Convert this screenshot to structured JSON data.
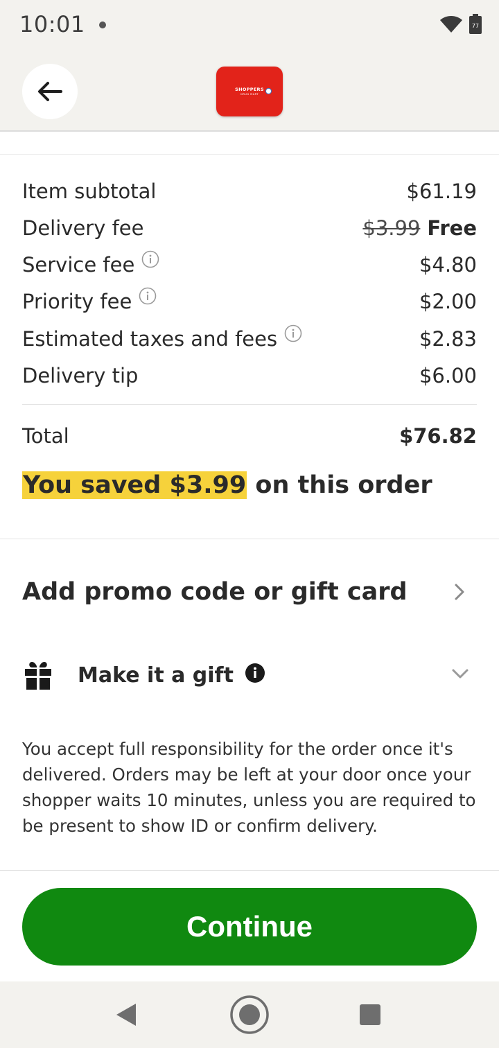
{
  "status_bar": {
    "time": "10:01",
    "battery_level": "77",
    "icons": [
      "wifi-icon",
      "battery-icon"
    ]
  },
  "header": {
    "back_icon": "arrow-left-icon",
    "store_logo": {
      "line1": "SHOPPERS",
      "line2": "DRUG MART",
      "color": "#e2231a"
    }
  },
  "fees": [
    {
      "label": "Item subtotal",
      "value": "$61.19",
      "has_info": false
    },
    {
      "label": "Delivery fee",
      "original_value": "$3.99",
      "value": "Free",
      "has_info": false
    },
    {
      "label": "Service fee",
      "value": "$4.80",
      "has_info": true
    },
    {
      "label": "Priority fee",
      "value": "$2.00",
      "has_info": true
    },
    {
      "label": "Estimated taxes and fees",
      "value": "$2.83",
      "has_info": true
    },
    {
      "label": "Delivery tip",
      "value": "$6.00",
      "has_info": false
    }
  ],
  "total": {
    "label": "Total",
    "value": "$76.82"
  },
  "savings": {
    "highlight": "You saved $3.99",
    "rest": " on this order",
    "highlight_color": "#f6d23b"
  },
  "promo": {
    "label": "Add promo code or gift card"
  },
  "gift": {
    "label": "Make it a gift"
  },
  "disclaimer": "You accept full responsibility for the order once it's delivered. Orders may be left at your door once your shopper waits 10 minutes, unless you are required to be present to show ID or confirm delivery.",
  "continue_button": {
    "label": "Continue",
    "color": "#108910"
  },
  "nav_bar": {
    "icons": [
      "nav-back-icon",
      "nav-home-icon",
      "nav-recents-icon"
    ]
  }
}
